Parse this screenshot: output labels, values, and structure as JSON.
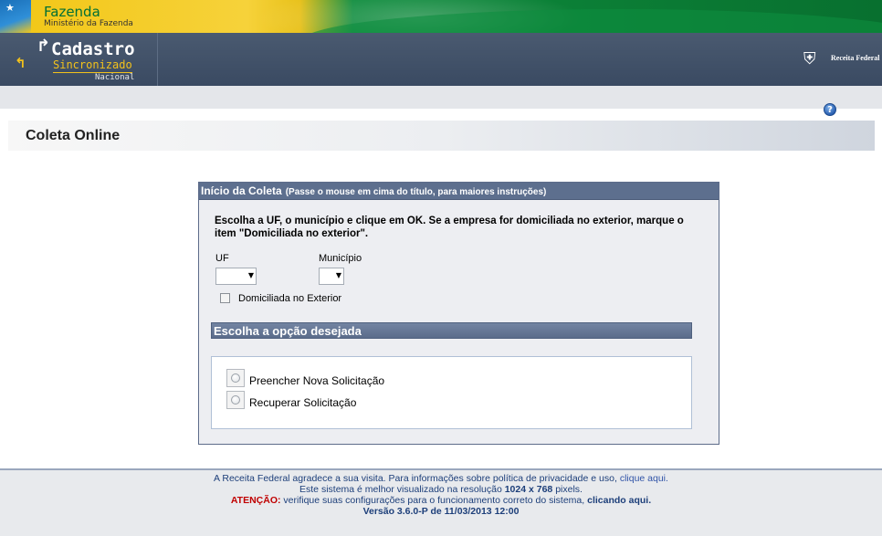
{
  "gov_banner": {
    "title": "Fazenda",
    "subtitle": "Ministério da Fazenda"
  },
  "app_header": {
    "product_word1": "Cadastro",
    "product_word2": "Sincronizado",
    "product_word3": "Nacional",
    "agency": "Receita Federal"
  },
  "page": {
    "title": "Coleta Online",
    "help_icon": "question-icon"
  },
  "panel": {
    "title": "Início da Coleta",
    "hint": "(Passe o mouse em cima do título, para maiores instruções)",
    "instructions": "Escolha a UF, o município e clique em OK. Se a empresa for domiciliada no exterior, marque o item \"Domiciliada no exterior\".",
    "uf_label": "UF",
    "uf_value": "",
    "municipio_label": "Município",
    "municipio_value": "",
    "domiciliada_label": "Domiciliada no Exterior",
    "domiciliada_checked": false,
    "option_section_title": "Escolha a opção desejada",
    "options": [
      {
        "label": "Preencher Nova Solicitação",
        "selected": false
      },
      {
        "label": "Recuperar Solicitação",
        "selected": false
      }
    ]
  },
  "footer": {
    "line1_text": "A Receita Federal agradece a sua visita. Para informações sobre política de privacidade e uso,",
    "line1_link": "clique aqui.",
    "line2_prefix": "Este sistema é melhor visualizado na resolução",
    "line2_resolution": "1024 x 768",
    "line2_suffix": "pixels.",
    "line3_warning": "ATENÇÃO:",
    "line3_text": "verifique suas configurações para o funcionamento correto do sistema,",
    "line3_link": "clicando aqui.",
    "version": "Versão 3.6.0-P de 11/03/2013 12:00"
  },
  "colors": {
    "header_bg": "#3e4e66",
    "accent_yellow": "#f3c21b",
    "panel_header": "#5d6f8e",
    "warning_red": "#c00000",
    "link_blue": "#3255a8"
  }
}
